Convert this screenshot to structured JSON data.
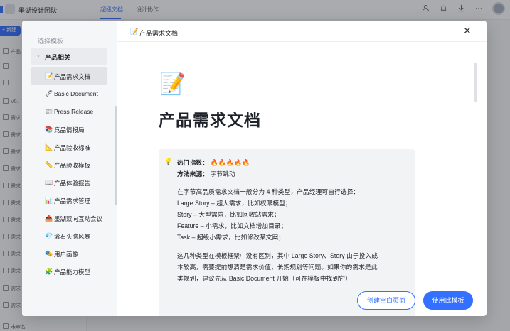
{
  "app": {
    "team_name": "墨湖设计团队",
    "tabs": [
      {
        "label": "超级文档",
        "active": true
      },
      {
        "label": "设计协作",
        "active": false
      }
    ],
    "new_button": "+ 新建",
    "nav_items": [
      "产品",
      "",
      "",
      "V0.",
      "需求",
      "需求",
      "需求",
      "需求",
      "需求",
      "需求",
      "需求",
      "需求",
      "需求",
      "需求",
      "需求",
      "需求",
      "未命名"
    ]
  },
  "modal": {
    "sidebar_title": "选择模板",
    "group_label": "产品相关",
    "templates": [
      {
        "emoji": "📝",
        "label": "产品需求文档",
        "active": true
      },
      {
        "emoji": "🖊",
        "label": "Basic Document",
        "active": false
      },
      {
        "emoji": "📰",
        "label": "Press Release",
        "active": false
      },
      {
        "emoji": "📚",
        "label": "竞品情报局",
        "active": false
      },
      {
        "emoji": "📐",
        "label": "产品验收标准",
        "active": false
      },
      {
        "emoji": "📏",
        "label": "产品验收模板",
        "active": false
      },
      {
        "emoji": "📖",
        "label": "产品体验报告",
        "active": false
      },
      {
        "emoji": "📊",
        "label": "产品需求管理",
        "active": false
      },
      {
        "emoji": "📤",
        "label": "墨湖双向互动会议",
        "active": false
      },
      {
        "emoji": "💎",
        "label": "滚石头脑风暴",
        "active": false
      },
      {
        "emoji": "🎭",
        "label": "用户画像",
        "active": false
      },
      {
        "emoji": "🧩",
        "label": "产品能力模型",
        "active": false
      }
    ],
    "header_emoji": "📝",
    "header_title": "产品需求文档",
    "preview": {
      "doc_icon": "📝",
      "doc_title": "产品需求文档",
      "bulb": "💡",
      "hot_label": "热门指数：",
      "hot_fires": "🔥🔥🔥🔥🔥",
      "source_label": "方法来源：",
      "source_value": "字节跳动",
      "lines": [
        "在字节高品质需求文档一般分为 4 种类型，产品经理可自行选择：",
        "Large Story – 超大需求，比如权限模型；",
        "Story – 大型需求，比如回收站需求；",
        "Feature – 小需求，比如文档增加目录；",
        "Task – 超级小需求，比如修改某文案；",
        "这几种类型在模板框架中没有区别，其中 Large Story、Story 由于投入成",
        "本较高，需要提前想清楚需求价值、长期规划等问题。如果你的需求是此",
        "类规划，建议先从 Basic Document 开始（可在模板中找到它）"
      ]
    },
    "btn_blank": "创建空白页面",
    "btn_use": "使用此模板"
  }
}
